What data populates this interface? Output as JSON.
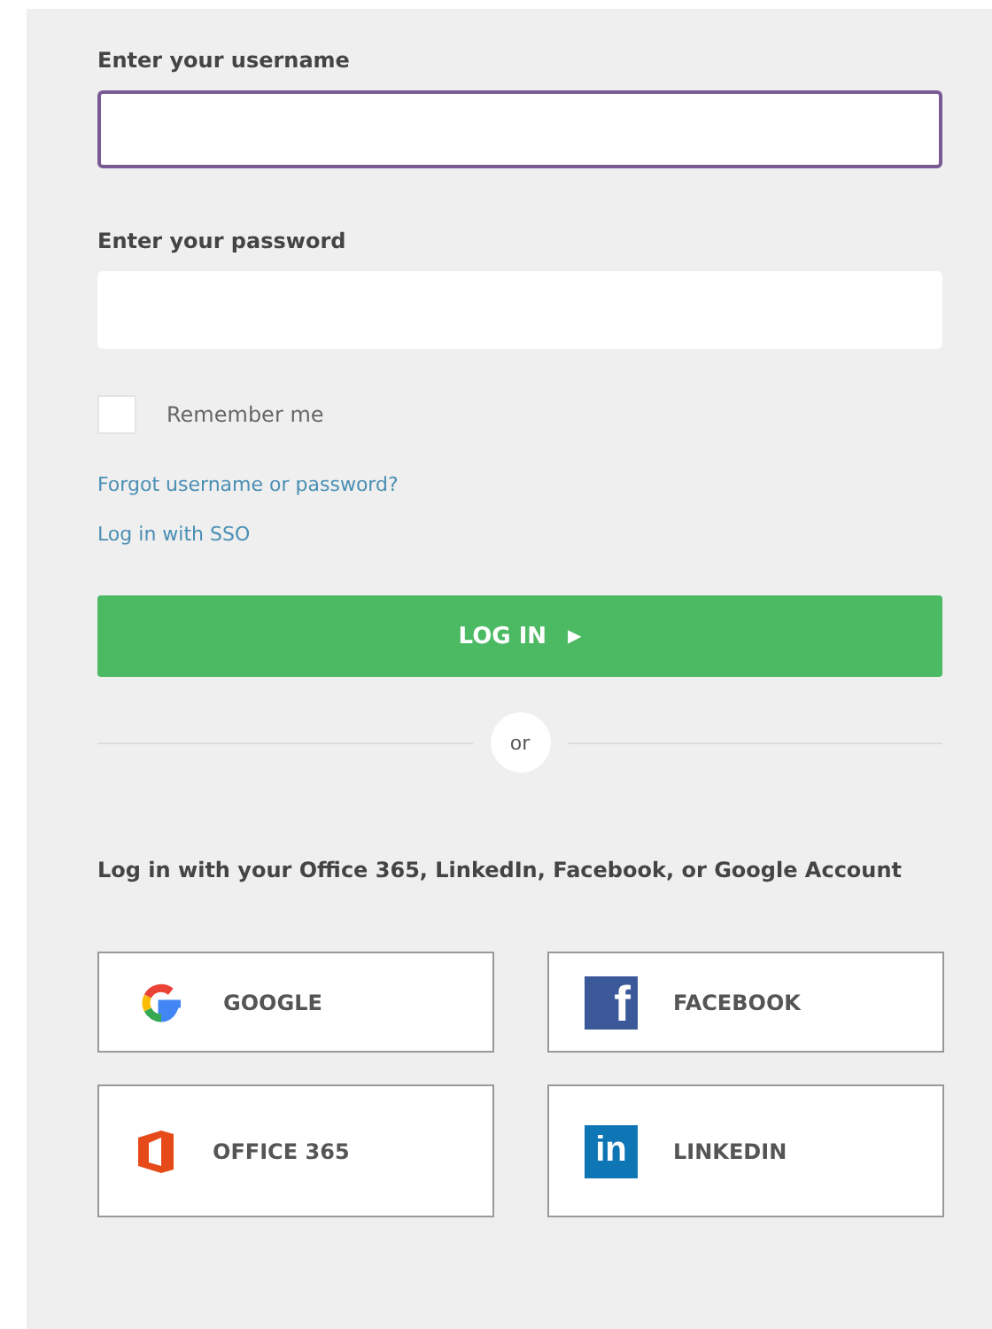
{
  "username": {
    "label": "Enter your username",
    "focused": true
  },
  "password": {
    "label": "Enter your password",
    "focused": false
  },
  "remember": {
    "label": "Remember me",
    "checked": false
  },
  "links": [
    "Forgot username or password?",
    "Log in with SSO"
  ],
  "login_button": {
    "label": "LOG IN",
    "arrow": "▶"
  },
  "divider": "or",
  "social_prompt": "Log in with your Office 365, LinkedIn, Facebook, or Google Account",
  "providers": [
    {
      "kind": "google",
      "label": "GOOGLE"
    },
    {
      "kind": "facebook",
      "label": "FACEBOOK",
      "glyph": "f"
    },
    {
      "kind": "office",
      "label": "OFFICE 365"
    },
    {
      "kind": "linkedin",
      "label": "LINKEDIN",
      "glyph": "in"
    }
  ]
}
